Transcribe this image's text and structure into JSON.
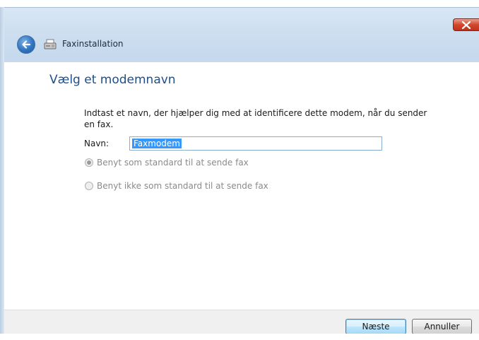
{
  "window": {
    "title": "Faxinstallation",
    "heading": "Vælg et modemnavn",
    "description": "Indtast et navn, der hjælper dig med at identificere dette modem, når du sender en fax."
  },
  "form": {
    "name_label": "Navn:",
    "name_value": "Faxmodem"
  },
  "options": [
    {
      "label": "Benyt som standard til at sende fax",
      "selected": true
    },
    {
      "label": "Benyt ikke som standard til at sende fax",
      "selected": false
    }
  ],
  "buttons": {
    "next": "Næste",
    "cancel": "Annuller"
  },
  "icons": {
    "back": "back-arrow-icon",
    "app": "fax-icon",
    "close": "close-icon"
  }
}
